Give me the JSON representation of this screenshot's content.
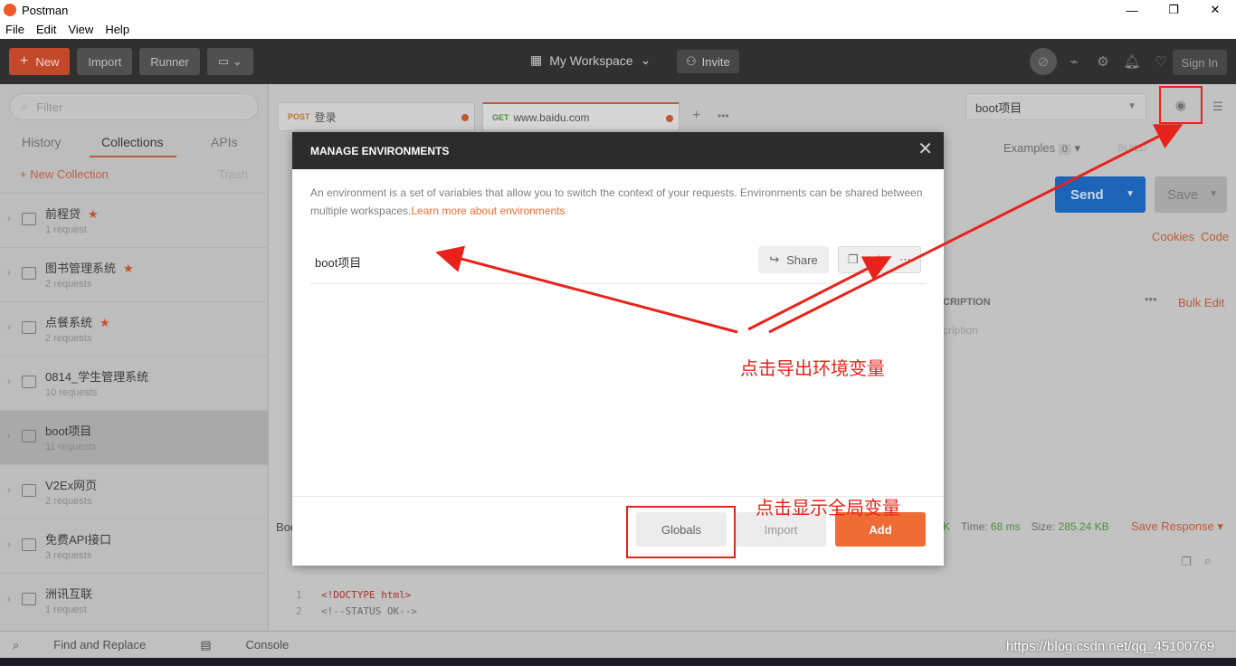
{
  "window": {
    "title": "Postman",
    "controls": [
      "—",
      "❐",
      "✕"
    ]
  },
  "menu": [
    "File",
    "Edit",
    "View",
    "Help"
  ],
  "toolbar": {
    "new_label": "New",
    "import_label": "Import",
    "runner_label": "Runner",
    "workspace_label": "My Workspace",
    "invite_label": "Invite",
    "signin_label": "Sign In"
  },
  "sidebar": {
    "filter_placeholder": "Filter",
    "tabs": [
      "History",
      "Collections",
      "APIs"
    ],
    "active_tab": "Collections",
    "new_collection_label": "+ New Collection",
    "trash_label": "Trash",
    "collections": [
      {
        "name": "前程贷",
        "count": "1 request",
        "starred": true
      },
      {
        "name": "图书管理系统",
        "count": "2 requests",
        "starred": true
      },
      {
        "name": "点餐系统",
        "count": "2 requests",
        "starred": true
      },
      {
        "name": "0814_学生管理系统",
        "count": "10 requests",
        "starred": false
      },
      {
        "name": "boot项目",
        "count": "11 requests",
        "starred": false,
        "active": true
      },
      {
        "name": "V2Ex网页",
        "count": "2 requests",
        "starred": false
      },
      {
        "name": "免费API接口",
        "count": "3 requests",
        "starred": false
      },
      {
        "name": "洲讯互联",
        "count": "1 request",
        "starred": false
      }
    ]
  },
  "request_tabs": [
    {
      "method": "POST",
      "title": "登录"
    },
    {
      "method": "GET",
      "title": "www.baidu.com"
    }
  ],
  "environment": {
    "selected": "boot项目"
  },
  "request": {
    "examples_label": "Examples",
    "examples_count": "0",
    "build_label": "BUILD",
    "send_label": "Send",
    "save_label": "Save",
    "cookies_label": "Cookies",
    "code_label": "Code",
    "bulk_edit_label": "Bulk Edit",
    "description_header": "CRIPTION",
    "description_placeholder": "cription"
  },
  "response": {
    "body_tab": "Boo",
    "status_ok": "K",
    "time_label": "Time:",
    "time_value": "68 ms",
    "size_label": "Size:",
    "size_value": "285.24 KB",
    "save_response_label": "Save Response",
    "code_lines": [
      {
        "n": "1",
        "text": "<!DOCTYPE html>"
      },
      {
        "n": "2",
        "text": "<!--STATUS OK-->"
      }
    ]
  },
  "footer": {
    "find_replace": "Find and Replace",
    "console": "Console"
  },
  "modal": {
    "title": "MANAGE ENVIRONMENTS",
    "description": "An environment is a set of variables that allow you to switch the context of your requests. Environments can be shared between multiple workspaces.",
    "learn_more": "Learn more about environments",
    "env_name": "boot项目",
    "share_label": "Share",
    "globals_label": "Globals",
    "import_label": "Import",
    "add_label": "Add"
  },
  "annotations": {
    "export_note": "点击导出环境变量",
    "globals_note": "点击显示全局变量",
    "highlight_color": "#e8231b"
  },
  "watermark": "https://blog.csdn.net/qq_45100769"
}
